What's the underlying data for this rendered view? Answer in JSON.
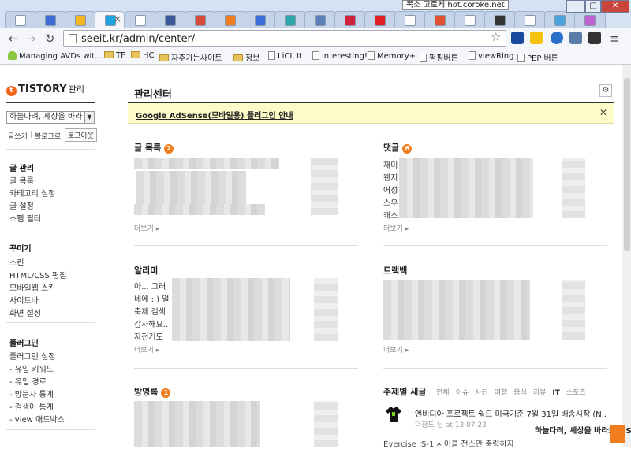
{
  "tooltip": "목소 고로케 hot.coroke.net",
  "window": {
    "minimize": "—",
    "restore": "▢",
    "close": "✕"
  },
  "tabs": [
    {
      "color": "#ffffff"
    },
    {
      "color": "#3b6cd8"
    },
    {
      "color": "#f3b520"
    },
    {
      "color": "#1ea2e0",
      "active": true
    },
    {
      "color": "#ffffff"
    },
    {
      "color": "#3b5998"
    },
    {
      "color": "#d84a3a"
    },
    {
      "color": "#f07d1e"
    },
    {
      "color": "#3b6cd8"
    },
    {
      "color": "#2aa7a7"
    },
    {
      "color": "#5b7fb8"
    },
    {
      "color": "#d0203c"
    },
    {
      "color": "#e02020"
    },
    {
      "color": "#ffffff"
    },
    {
      "color": "#e05030"
    },
    {
      "color": "#ffffff"
    },
    {
      "color": "#333333"
    },
    {
      "color": "#ffffff"
    },
    {
      "color": "#4aa3df"
    },
    {
      "color": "#c060d0"
    }
  ],
  "toolbar": {
    "back": "←",
    "forward": "→",
    "reload": "↻",
    "url": "seeit.kr/admin/center/",
    "star": "☆",
    "menu": "≡"
  },
  "bookmarks": [
    {
      "label": "Managing AVDs wit...",
      "icon": "android"
    },
    {
      "label": "TF",
      "icon": "folder"
    },
    {
      "label": "HC",
      "icon": "folder"
    },
    {
      "label": "자주가는사이트",
      "icon": "folder"
    },
    {
      "label": "정보",
      "icon": "folder"
    },
    {
      "label": "LiCL It",
      "icon": "page"
    },
    {
      "label": "interesting!",
      "icon": "page"
    },
    {
      "label": "Memory+",
      "icon": "page"
    },
    {
      "label": "펌핑버튼",
      "icon": "page"
    },
    {
      "label": "viewRing",
      "icon": "page"
    },
    {
      "label": "PEP 버튼",
      "icon": "page"
    }
  ],
  "sidebar": {
    "logo": "TISTORY",
    "logo_sub": "관리",
    "blog_select": "하늘다려, 세상을 바라",
    "write": "글쓰기",
    "blog_home": "블로그로",
    "logout": "로그아웃",
    "groups": [
      {
        "title": "글 관리",
        "items": [
          "글 목록",
          "카테고리 설정",
          "글 설정",
          "스팸 필터"
        ]
      },
      {
        "title": "꾸미기",
        "items": [
          "스킨",
          "HTML/CSS 편집",
          "모바일웹 스킨",
          "사이드바",
          "화면 설정"
        ]
      },
      {
        "title": "플러그인",
        "items": [
          "플러그인 설정",
          "- 유입 키워드",
          "- 유입 경로",
          "- 방문자 통계",
          "- 검색어 통계",
          "- view 애드박스"
        ]
      }
    ]
  },
  "main": {
    "title": "관리센터",
    "notice": "Google AdSense(모바일용) 플러그인 안내",
    "notice_close": "✕",
    "more": "더보기 ▸",
    "sections": {
      "posts": {
        "title": "글 목록",
        "count": "2"
      },
      "comments": {
        "title": "댓글",
        "count": "6",
        "rows": [
          "재미",
          "왠지",
          "어성",
          "스우",
          "캐스"
        ]
      },
      "notifications": {
        "title": "알리미",
        "rows": [
          "아... 그러",
          "네에 : ) 얼",
          "축제 검색",
          "감사해요..",
          "자전거도"
        ]
      },
      "trackback": {
        "title": "트랙백"
      },
      "guestbook": {
        "title": "방명록",
        "count": "1"
      },
      "topic": {
        "title": "주제별 새글",
        "categories": [
          "전체",
          "이슈",
          "사진",
          "여행",
          "음식",
          "리뷰",
          "IT",
          "스포츠"
        ],
        "active_category": "IT",
        "news_title": "엔비디아 프로젝트 쉴드 미국기준 7월 31일 배송시작 (N..",
        "news_meta": "더청도 님 at 13.07.23",
        "news_next": "Evercise IS-1 사이클 전스만 축력하자"
      }
    }
  },
  "watermark": "하늘다려, 세상을 바라보다 Seeit.kr"
}
